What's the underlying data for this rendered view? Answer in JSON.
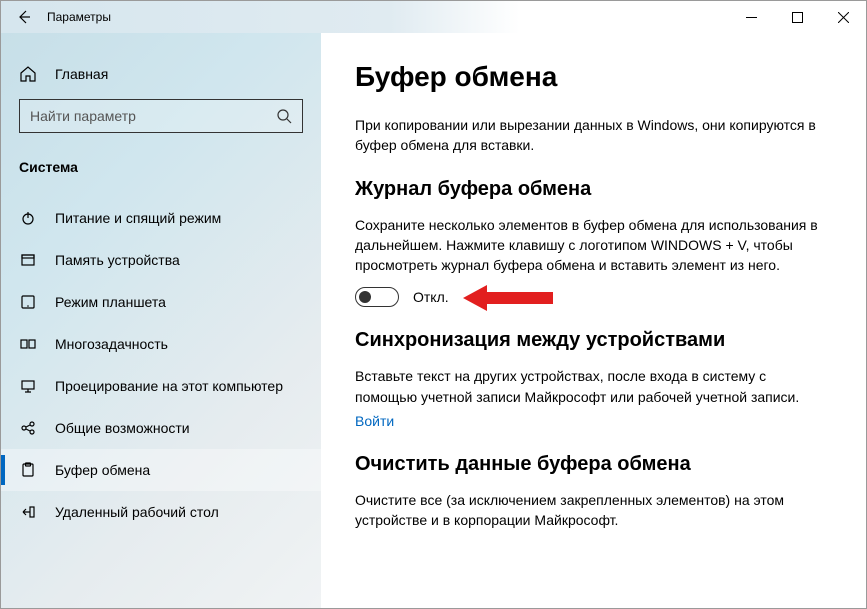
{
  "window": {
    "title": "Параметры"
  },
  "sidebar": {
    "home": "Главная",
    "search_placeholder": "Найти параметр",
    "category": "Система",
    "items": [
      {
        "label": "Питание и спящий режим",
        "icon": "power-icon",
        "selected": false
      },
      {
        "label": "Память устройства",
        "icon": "storage-icon",
        "selected": false
      },
      {
        "label": "Режим планшета",
        "icon": "tablet-icon",
        "selected": false
      },
      {
        "label": "Многозадачность",
        "icon": "multitask-icon",
        "selected": false
      },
      {
        "label": "Проецирование на этот компьютер",
        "icon": "project-icon",
        "selected": false
      },
      {
        "label": "Общие возможности",
        "icon": "shared-icon",
        "selected": false
      },
      {
        "label": "Буфер обмена",
        "icon": "clipboard-icon",
        "selected": true
      },
      {
        "label": "Удаленный рабочий стол",
        "icon": "remote-icon",
        "selected": false
      }
    ]
  },
  "content": {
    "title": "Буфер обмена",
    "intro": "При копировании или вырезании данных в Windows, они копируются в буфер обмена для вставки.",
    "section1": {
      "heading": "Журнал буфера обмена",
      "text": "Сохраните несколько элементов в буфер обмена для использования в дальнейшем. Нажмите клавишу с логотипом WINDOWS + V, чтобы просмотреть журнал буфера обмена и вставить элемент из него.",
      "toggle_label": "Откл."
    },
    "section2": {
      "heading": "Синхронизация между устройствами",
      "text": "Вставьте текст на других устройствах, после входа в систему с помощью учетной записи Майкрософт или рабочей учетной записи.",
      "link": "Войти"
    },
    "section3": {
      "heading": "Очистить данные буфера обмена",
      "text": "Очистите все (за исключением закрепленных элементов) на этом устройстве и в корпорации Майкрософт."
    }
  }
}
